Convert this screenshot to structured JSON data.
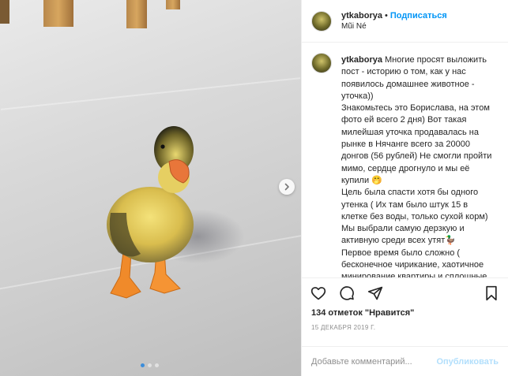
{
  "post": {
    "username": "ytkaborya",
    "separator": "•",
    "follow_label": "Подписаться",
    "location": "Mũi Né",
    "caption_text": "Многие просят выложить пост - историю о том, как у нас появилось домашнее животное - уточка))\nЗнакомьтесь это Борислава, на этом фото ей всего 2 дня) Вот такая милейшая уточка продавалась на рынке в Нячанге всего за 20000 донгов (56 рублей) Не смогли пройти мимо, сердце дрогнуло и мы её купили 🤭\nЦель была спасти хотя бы одного утенка ( Их там было штук 15 в клетке без воды, только сухой корм) Мы выбрали самую дерзкую и активную среди всех утят🦆\nПервое время было сложно ( бесконечное чирикание, хаотичное минирование квартиры и сплошные недосыпы) но сейчас мы",
    "likes_text": "134 отметок \"Нравится\"",
    "date_text": "15 ДЕКАБРЯ 2019 Г.",
    "comment_placeholder": "Добавьте комментарий...",
    "publish_label": "Опубликовать"
  },
  "media": {
    "slide_count": 3,
    "active_slide": 1
  },
  "icons": {
    "like": "heart-icon",
    "comment": "comment-icon",
    "share": "share-icon",
    "save": "bookmark-icon",
    "next": "chevron-right-icon"
  },
  "colors": {
    "link": "#0095f6",
    "publish_disabled": "#b2dffc",
    "muted": "#8e8e8e"
  }
}
